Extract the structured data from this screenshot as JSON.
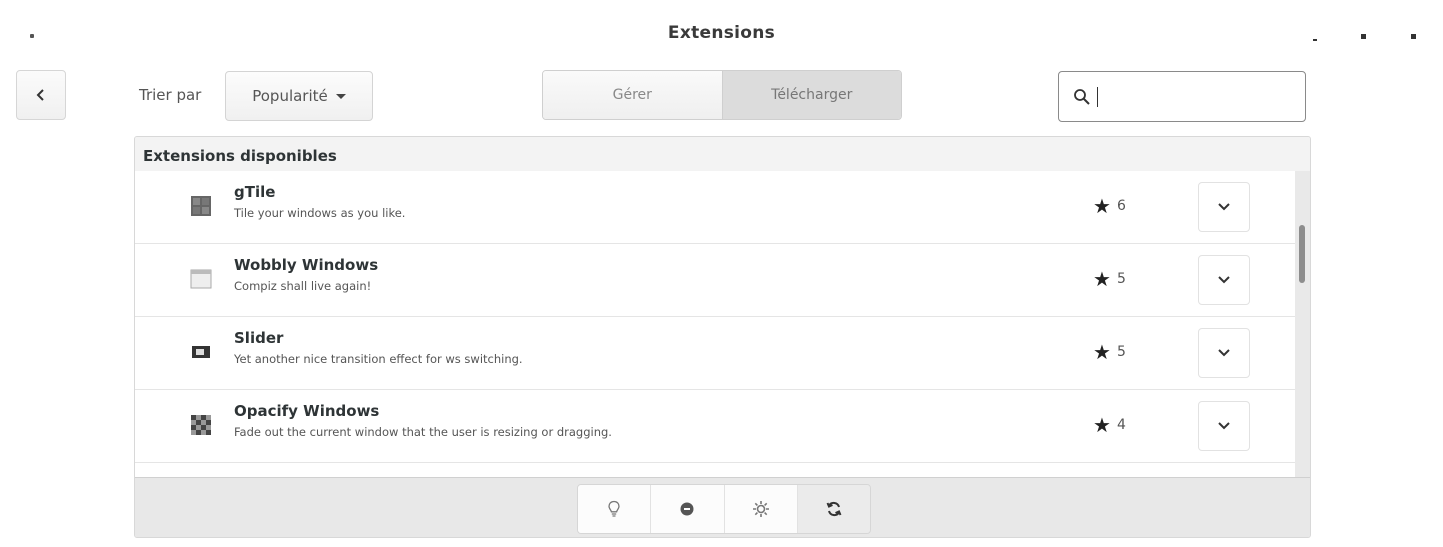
{
  "window": {
    "title": "Extensions"
  },
  "toolbar": {
    "sort_label": "Trier par",
    "sort_value": "Popularité",
    "tabs": [
      {
        "label": "Gérer",
        "active": false
      },
      {
        "label": "Télécharger",
        "active": true
      }
    ],
    "search_value": ""
  },
  "panel": {
    "heading": "Extensions disponibles",
    "extensions": [
      {
        "name": "gTile",
        "description": "Tile your windows as you like.",
        "rating": "6",
        "icon": "gtile-icon"
      },
      {
        "name": "Wobbly Windows",
        "description": "Compiz shall live again!",
        "rating": "5",
        "icon": "wobbly-windows-icon"
      },
      {
        "name": "Slider",
        "description": "Yet another nice transition effect for ws switching.",
        "rating": "5",
        "icon": "slider-icon"
      },
      {
        "name": "Opacify Windows",
        "description": "Fade out the current window that the user is resizing or dragging.",
        "rating": "4",
        "icon": "opacify-windows-icon"
      }
    ]
  },
  "footer_tools": [
    {
      "icon": "lightbulb-icon"
    },
    {
      "icon": "remove-icon"
    },
    {
      "icon": "settings-icon"
    },
    {
      "icon": "refresh-icon"
    }
  ],
  "colors": {
    "accent": "#2e3436",
    "panel_bg": "#f3f3f3",
    "active_tab": "#dcdcdc"
  }
}
